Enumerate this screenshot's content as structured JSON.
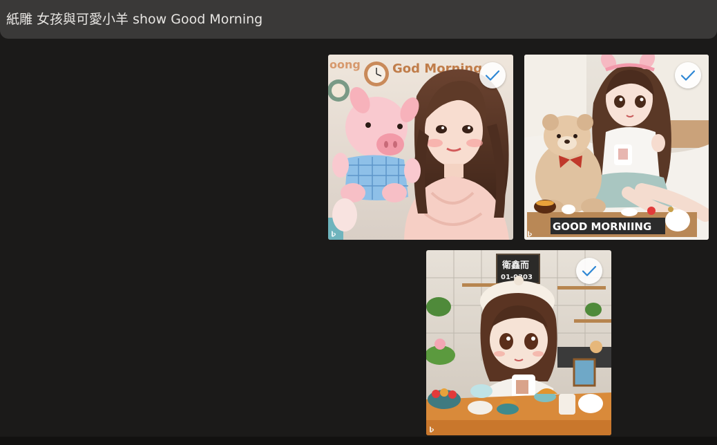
{
  "prompt": {
    "text": "紙雕 女孩與可愛小羊 show Good Morning"
  },
  "results": [
    {
      "alt": "Girl with pink plush pig",
      "sign": "God Morning",
      "sign_partial": "oong",
      "selected": true,
      "icon": "check-icon"
    },
    {
      "alt": "Doll girl with teddy bear and breakfast tray",
      "sign": "GOOD MORNIING",
      "selected": true,
      "icon": "check-icon"
    },
    {
      "alt": "Chibi girl with beret at breakfast table",
      "sign_line1": "衛鑫而",
      "sign_line2": "01-0303",
      "selected": true,
      "icon": "check-icon"
    }
  ],
  "colors": {
    "background": "#1b1a19",
    "prompt_bar": "#3a3938",
    "check_stroke": "#2d86d4"
  }
}
